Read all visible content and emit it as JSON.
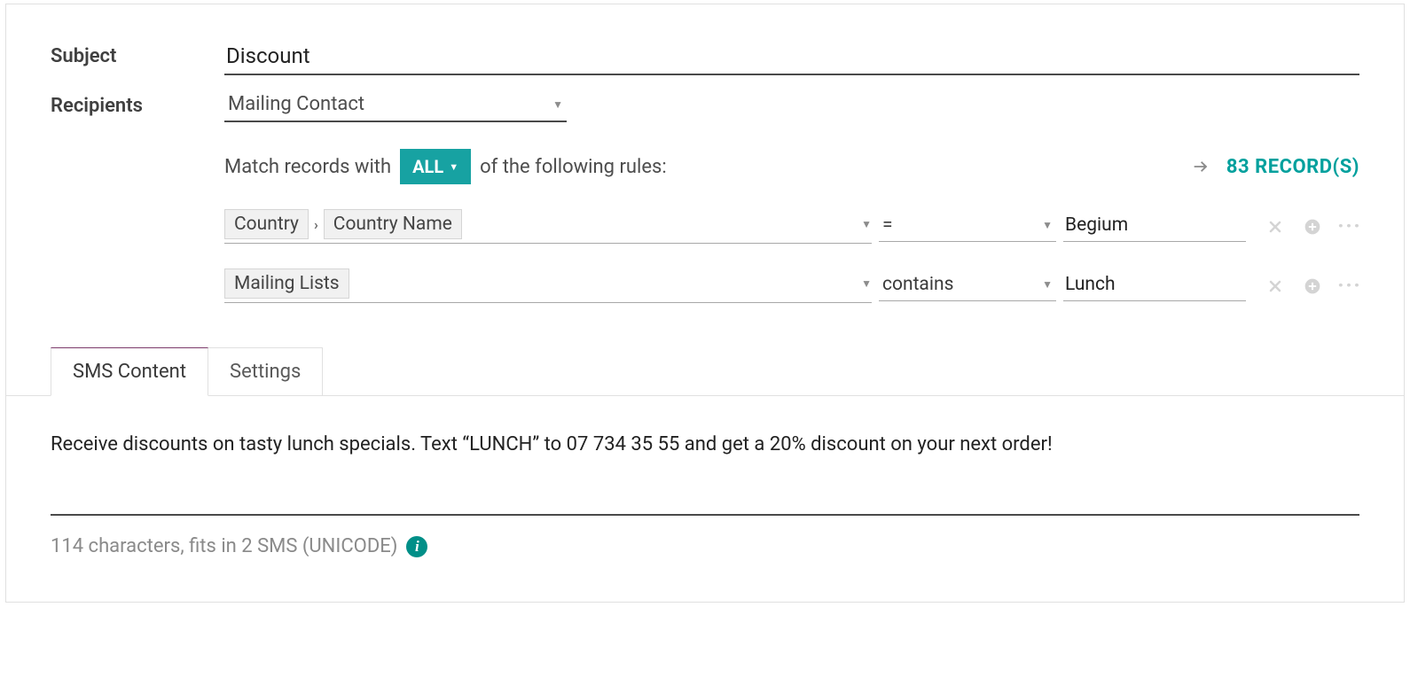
{
  "labels": {
    "subject": "Subject",
    "recipients": "Recipients"
  },
  "subject_value": "Discount",
  "recipients_select": "Mailing Contact",
  "match": {
    "prefix": "Match records with",
    "mode": "ALL",
    "suffix": "of the following rules:"
  },
  "records": {
    "count": 83,
    "label": "RECORD(S)"
  },
  "rules": [
    {
      "field_chain": [
        "Country",
        "Country Name"
      ],
      "operator": "=",
      "value": "Begium"
    },
    {
      "field_chain": [
        "Mailing Lists"
      ],
      "operator": "contains",
      "value": "Lunch"
    }
  ],
  "tabs": [
    "SMS Content",
    "Settings"
  ],
  "active_tab": 0,
  "sms_text": "Receive discounts on tasty lunch specials. Text “LUNCH” to 07 734 35 55 and get a 20% discount on your next order!",
  "char_info": "114 characters, fits in 2 SMS (UNICODE)"
}
